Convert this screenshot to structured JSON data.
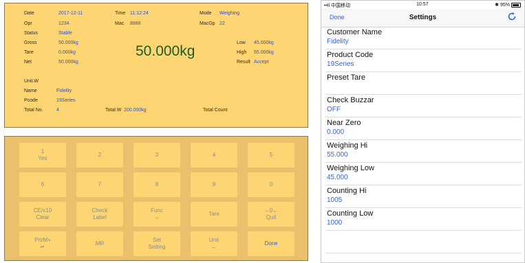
{
  "display": {
    "date_label": "Date",
    "date_value": "2017-12-11",
    "time_label": "Time",
    "time_value": "11:12:24",
    "mode_label": "Mode",
    "mode_value": "Weighing",
    "opr_label": "Opr",
    "opr_value": "1234",
    "mac_label": "Mac",
    "mac_value": "8888",
    "macgp_label": "MacGp",
    "macgp_value": "22",
    "status_label": "Status",
    "status_value": "Stable",
    "gross_label": "Gross",
    "gross_value": "50.000kg",
    "tare_label": "Tare",
    "tare_value": "0.000kg",
    "net_label": "Net",
    "net_value": "50.000kg",
    "low_label": "Low",
    "low_value": "45.000kg",
    "high_label": "High",
    "high_value": "55.000kg",
    "result_label": "Result",
    "result_value": "Accept",
    "main_weight": "50.000kg",
    "unitw_label": "Unit.W",
    "name_label": "Name",
    "name_value": "Fidelity",
    "pcode_label": "Pcode",
    "pcode_value": "19Series",
    "totalno_label": "Total No.",
    "totalno_value": "4",
    "totalw_label": "Total.W",
    "totalw_value": "200.000kg",
    "totalcount_label": "Total Count"
  },
  "keypad": {
    "k1_top": "1",
    "k1_bottom": "Yes",
    "k2": "2",
    "k3": "3",
    "k4": "4",
    "k5": "5",
    "k6": "6",
    "k7": "7",
    "k8": "8",
    "k9": "9",
    "k0": "0",
    "k_clear_top": "CE/x10",
    "k_clear_bottom": "Clear",
    "k_check_top": "Check",
    "k_check_bottom": "Label",
    "k_func_top": "Func",
    "k_func_bottom": "→",
    "k_tare": "Tare",
    "k_quit_top": "→0←",
    "k_quit_bottom": "Quit",
    "k_prt_top": "Prt/M+",
    "k_prt_bottom": "↵",
    "k_mr": "MR",
    "k_set_top": "Set",
    "k_set_bottom": "Setting",
    "k_unit_top": "Unit",
    "k_unit_bottom": "←",
    "k_done": "Done"
  },
  "phone": {
    "status_left": "••ll 中国移动 ",
    "status_time": "10:57",
    "status_right": "✱ 95%",
    "done_label": "Done",
    "title": "Settings",
    "refresh_icon": "refresh-icon",
    "rows": [
      {
        "name": "Customer Name",
        "value": "Fidelity"
      },
      {
        "name": "Product Code",
        "value": "19Series"
      },
      {
        "name": "Preset Tare",
        "value": ""
      },
      {
        "name": "Check Buzzar",
        "value": "OFF"
      },
      {
        "name": "Near Zero",
        "value": "0.000"
      },
      {
        "name": "Weighing Hi",
        "value": "55.000"
      },
      {
        "name": "Weighing Low",
        "value": "45.000"
      },
      {
        "name": "Counting Hi",
        "value": "1005"
      },
      {
        "name": "Counting Low",
        "value": "1000"
      }
    ]
  }
}
